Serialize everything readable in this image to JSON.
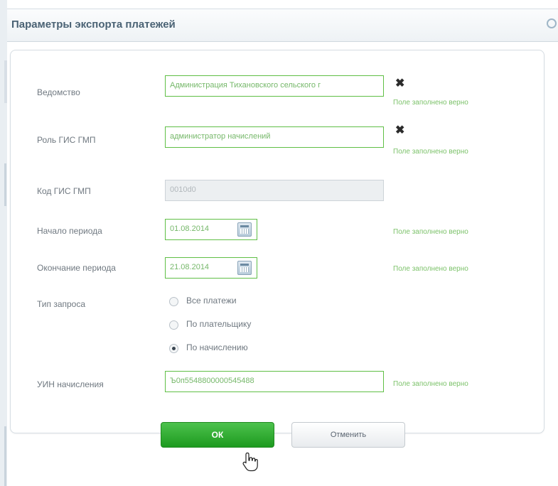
{
  "dialog": {
    "title": "Параметры экспорта платежей"
  },
  "form": {
    "department": {
      "label": "Ведомство",
      "value": "Администрация Тихановского сельского г",
      "status": "Поле заполнено верно"
    },
    "role": {
      "label": "Роль ГИС ГМП",
      "value": "администратор начислений",
      "status": "Поле заполнено верно"
    },
    "code": {
      "label": "Код ГИС ГМП",
      "value": "0010d0"
    },
    "period_start": {
      "label": "Начало периода",
      "value": "01.08.2014",
      "status": "Поле заполнено верно"
    },
    "period_end": {
      "label": "Окончание периода",
      "value": "21.08.2014",
      "status": "Поле заполнено верно"
    },
    "request_type": {
      "label": "Тип запроса",
      "options": [
        "Все платежи",
        "По плательщику",
        "По начислению"
      ],
      "selected": "По начислению"
    },
    "uin": {
      "label": "УИН начисления",
      "value": "Ъ0п5548800000545488",
      "status": "Поле заполнено верно"
    }
  },
  "buttons": {
    "ok": "ОК",
    "cancel": "Отменить"
  },
  "icons": {
    "clear": "clear-x-icon",
    "calendar": "calendar-icon",
    "close": "close-icon",
    "cursor": "hand-pointer-icon"
  },
  "colors": {
    "valid_border": "#5fbf45",
    "valid_text": "#7cc26a",
    "ok_button": "#2aa82a",
    "title": "#4a6274"
  }
}
